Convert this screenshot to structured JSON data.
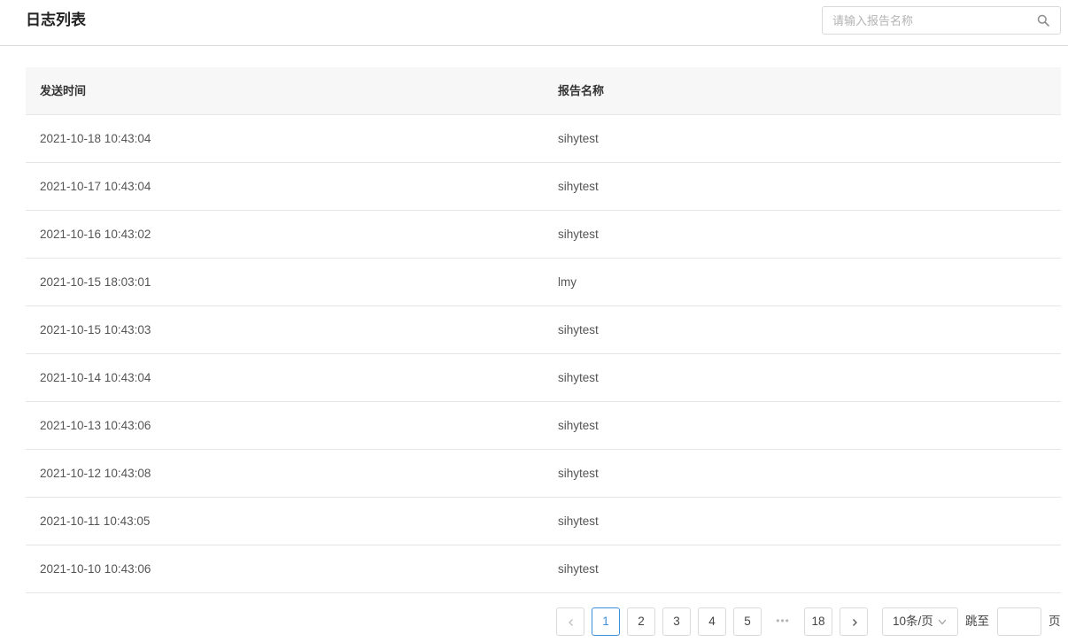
{
  "header": {
    "title": "日志列表",
    "search_placeholder": "请输入报告名称",
    "search_value": ""
  },
  "table": {
    "columns": [
      "发送时间",
      "报告名称"
    ],
    "rows": [
      {
        "time": "2021-10-18 10:43:04",
        "name": "sihytest"
      },
      {
        "time": "2021-10-17 10:43:04",
        "name": "sihytest"
      },
      {
        "time": "2021-10-16 10:43:02",
        "name": "sihytest"
      },
      {
        "time": "2021-10-15 18:03:01",
        "name": "lmy"
      },
      {
        "time": "2021-10-15 10:43:03",
        "name": "sihytest"
      },
      {
        "time": "2021-10-14 10:43:04",
        "name": "sihytest"
      },
      {
        "time": "2021-10-13 10:43:06",
        "name": "sihytest"
      },
      {
        "time": "2021-10-12 10:43:08",
        "name": "sihytest"
      },
      {
        "time": "2021-10-11 10:43:05",
        "name": "sihytest"
      },
      {
        "time": "2021-10-10 10:43:06",
        "name": "sihytest"
      }
    ]
  },
  "pagination": {
    "current_page": "1",
    "pages": [
      "1",
      "2",
      "3",
      "4",
      "5"
    ],
    "ellipsis": "•••",
    "last_page": "18",
    "page_size": "10条/页",
    "jump_label": "跳至",
    "jump_value": "",
    "page_unit": "页",
    "prev_icon": "chevron-left-icon",
    "next_icon": "chevron-right-icon"
  },
  "colors": {
    "accent": "#3d8fdb",
    "header_bg": "#f7f7f7",
    "border": "#d9d9d9"
  }
}
